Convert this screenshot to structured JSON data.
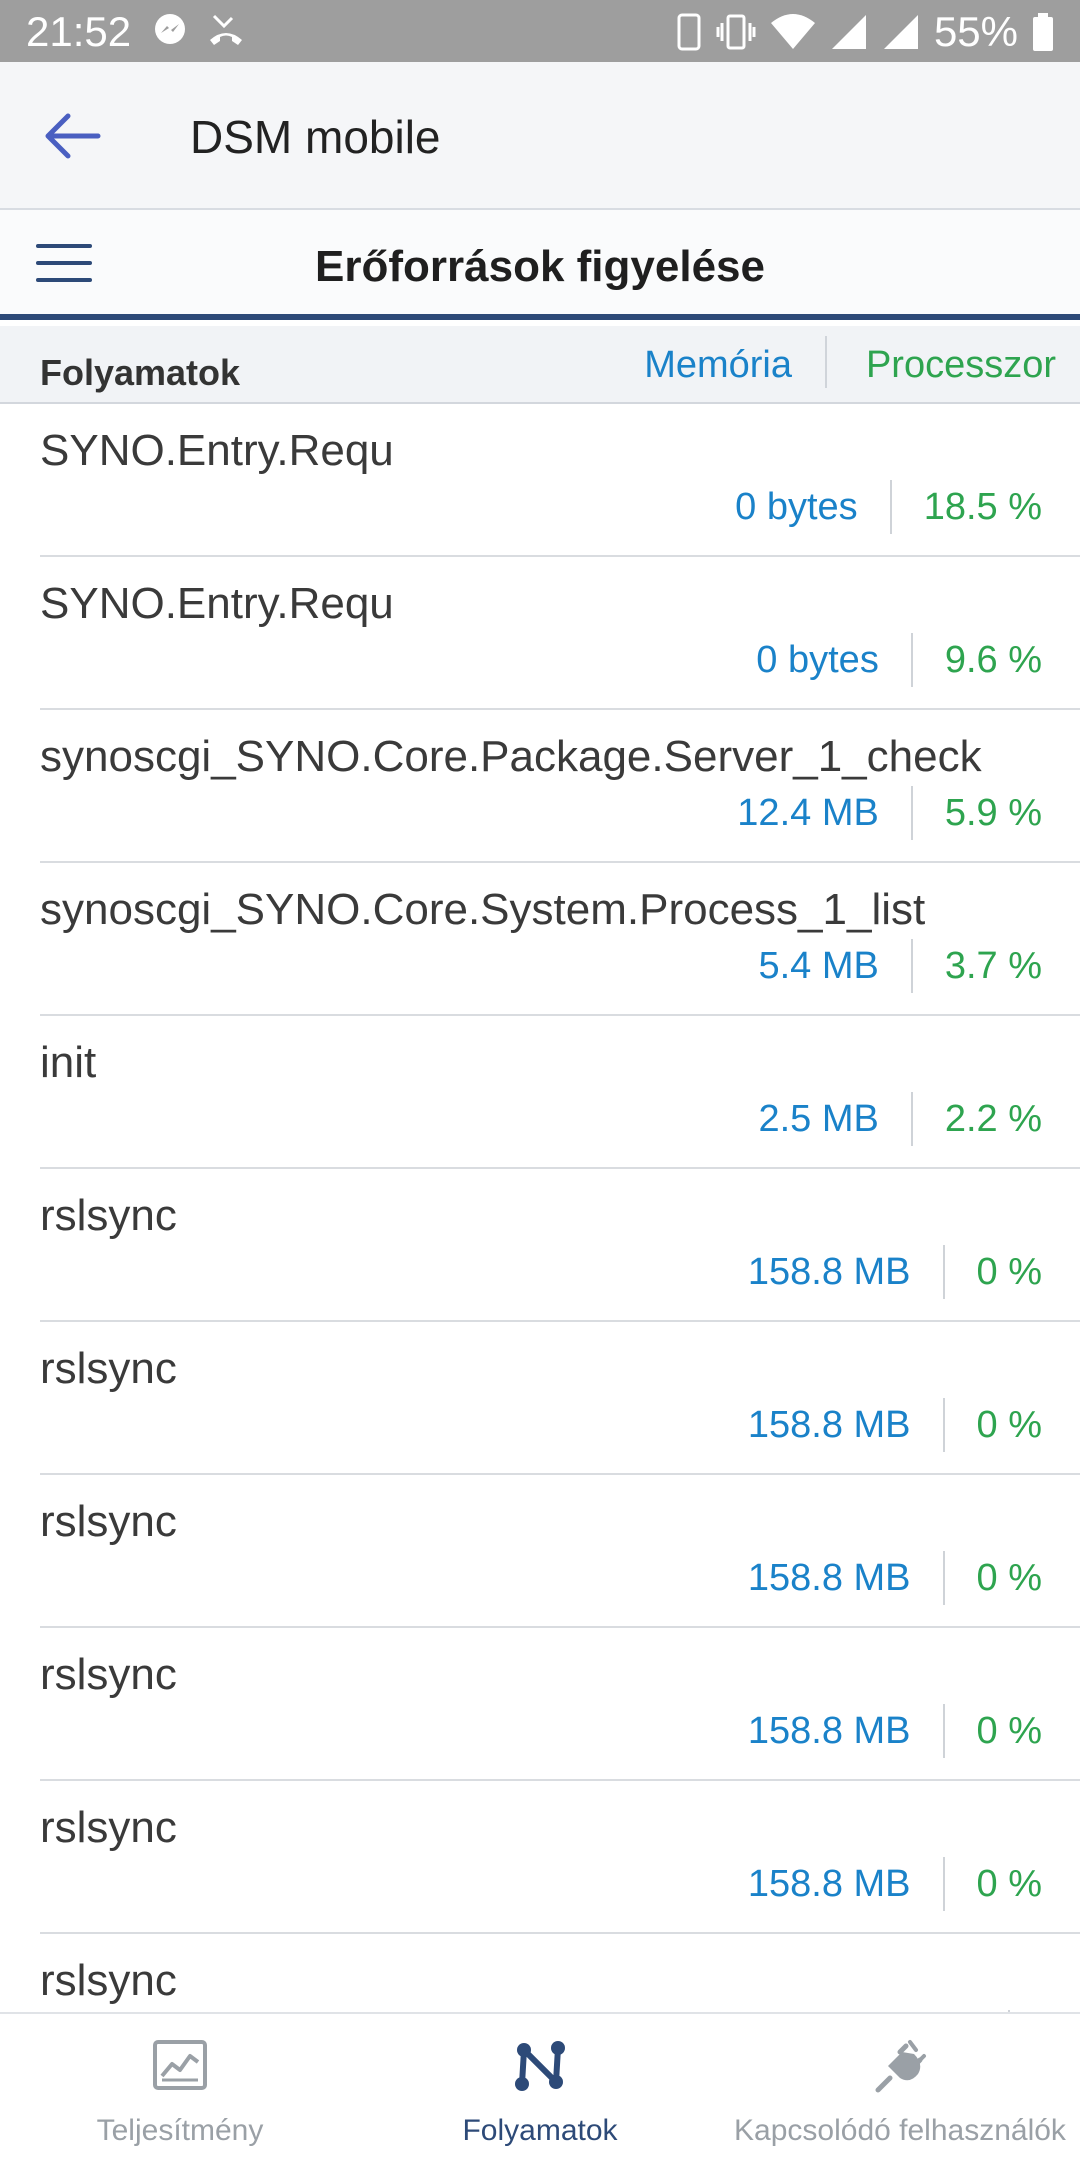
{
  "status_bar": {
    "time": "21:52",
    "battery": "55%",
    "icons": [
      "messenger-icon",
      "missed-call-icon",
      "phone-portrait-icon",
      "vibrate-icon",
      "wifi-icon",
      "signal-icon",
      "signal-icon-2",
      "battery-icon"
    ]
  },
  "app_bar": {
    "title": "DSM mobile",
    "back_icon": "arrow-left-icon"
  },
  "header": {
    "title": "Erőforrások figyelése",
    "menu_icon": "hamburger-menu-icon"
  },
  "columns": {
    "name": "Folyamatok",
    "memory": "Memória",
    "cpu": "Processzor"
  },
  "processes": [
    {
      "name": "SYNO.Entry.Requ",
      "memory": "0 bytes",
      "cpu": "18.5 %"
    },
    {
      "name": "SYNO.Entry.Requ",
      "memory": "0 bytes",
      "cpu": "9.6 %"
    },
    {
      "name": "synoscgi_SYNO.Core.Package.Server_1_check",
      "memory": "12.4 MB",
      "cpu": "5.9 %"
    },
    {
      "name": "synoscgi_SYNO.Core.System.Process_1_list",
      "memory": "5.4 MB",
      "cpu": "3.7 %"
    },
    {
      "name": "init",
      "memory": "2.5 MB",
      "cpu": "2.2 %"
    },
    {
      "name": "rslsync",
      "memory": "158.8 MB",
      "cpu": "0 %"
    },
    {
      "name": "rslsync",
      "memory": "158.8 MB",
      "cpu": "0 %"
    },
    {
      "name": "rslsync",
      "memory": "158.8 MB",
      "cpu": "0 %"
    },
    {
      "name": "rslsync",
      "memory": "158.8 MB",
      "cpu": "0 %"
    },
    {
      "name": "rslsync",
      "memory": "158.8 MB",
      "cpu": "0 %"
    },
    {
      "name": "rslsync",
      "memory": "",
      "cpu": ""
    }
  ],
  "bottom_nav": [
    {
      "label": "Teljesítmény",
      "icon": "performance-chart-icon",
      "active": false
    },
    {
      "label": "Folyamatok",
      "icon": "processes-icon",
      "active": true
    },
    {
      "label": "Kapcsolódó felhasználók",
      "icon": "plug-icon",
      "active": false
    }
  ],
  "colors": {
    "accent": "#2d4a78",
    "memory": "#1a82c9",
    "cpu": "#2ea44f",
    "status_bar": "#9e9e9e"
  }
}
